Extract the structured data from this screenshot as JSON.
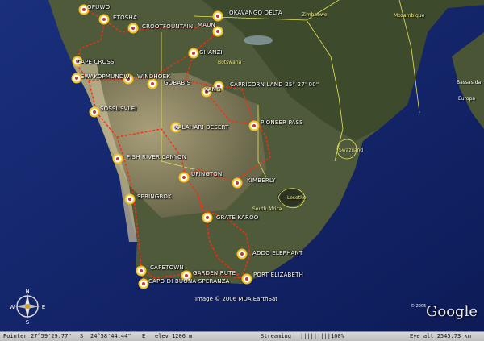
{
  "route_places": [
    {
      "id": "opuwo",
      "label": "OPUWO"
    },
    {
      "id": "etosha",
      "label": "ETOSHA"
    },
    {
      "id": "okavango",
      "label": "OKAVANGO DELTA"
    },
    {
      "id": "crocfountain",
      "label": "CROOTFOUNTAIN"
    },
    {
      "id": "maun",
      "label": "MAUN"
    },
    {
      "id": "ghanzi",
      "label": "GHANZI"
    },
    {
      "id": "capecross",
      "label": "CAPE CROSS"
    },
    {
      "id": "swakopmund",
      "label": "SWAKOPMUNDW"
    },
    {
      "id": "windhoek",
      "label": "WINDHOEK"
    },
    {
      "id": "gobabis",
      "label": "GOBABIS"
    },
    {
      "id": "kang",
      "label": "KANG"
    },
    {
      "id": "capricorn",
      "label": "CAPRICORN LAND   25° 27' 00\""
    },
    {
      "id": "sossusvlei",
      "label": "SOSSUSVLEI"
    },
    {
      "id": "kalahari",
      "label": "KALAHARI DESERT"
    },
    {
      "id": "pioneer",
      "label": "PIONEER PASS"
    },
    {
      "id": "fishriver",
      "label": "FISH RIVER CANYON"
    },
    {
      "id": "upington",
      "label": "UPINGTON"
    },
    {
      "id": "kimberly",
      "label": "KIMBERLY"
    },
    {
      "id": "springbok",
      "label": "SPRINGBOK"
    },
    {
      "id": "grandkaroo",
      "label": "GRATE KAROO"
    },
    {
      "id": "addo",
      "label": "ADDO ELEPHANT"
    },
    {
      "id": "capetown",
      "label": "CAPETOWN"
    },
    {
      "id": "gardenroute",
      "label": "GARDEN RUTE"
    },
    {
      "id": "portelizabeth",
      "label": "PORT ELIZABETH"
    },
    {
      "id": "capebuona",
      "label": "CAPO DI BUONA SPERANZA"
    }
  ],
  "country_labels": {
    "zimbabwe": "Zimbabwe",
    "mozambique": "Mozambique",
    "botswana": "Botswana",
    "swaziland": "Swaziland",
    "lesotho": "Lesotho",
    "south_africa": "South Africa",
    "bassas": "Bassas da",
    "europa": "Europa"
  },
  "imagery_credit": "Image © 2006 MDA EarthSat",
  "copyright": "© 2005",
  "logo": "Google",
  "compass": {
    "north": "N",
    "south": "S",
    "east": "E",
    "west": "W"
  },
  "status": {
    "pointer_label": "Pointer",
    "lat": "27°59'29.77\"",
    "lat_hemi": "S",
    "lon": "24°58'44.44\"",
    "lon_hemi": "E",
    "elevation": "elev 1206 m",
    "streaming_label": "Streaming",
    "streaming_bar": "||||||||||",
    "streaming_pct": "100%",
    "eye_alt": "Eye alt  2545.73 km"
  },
  "colors": {
    "route": "#ff2a12",
    "border": "#e6e35a",
    "ocean": "#14276d",
    "marker_ring": "#f4c21b"
  }
}
